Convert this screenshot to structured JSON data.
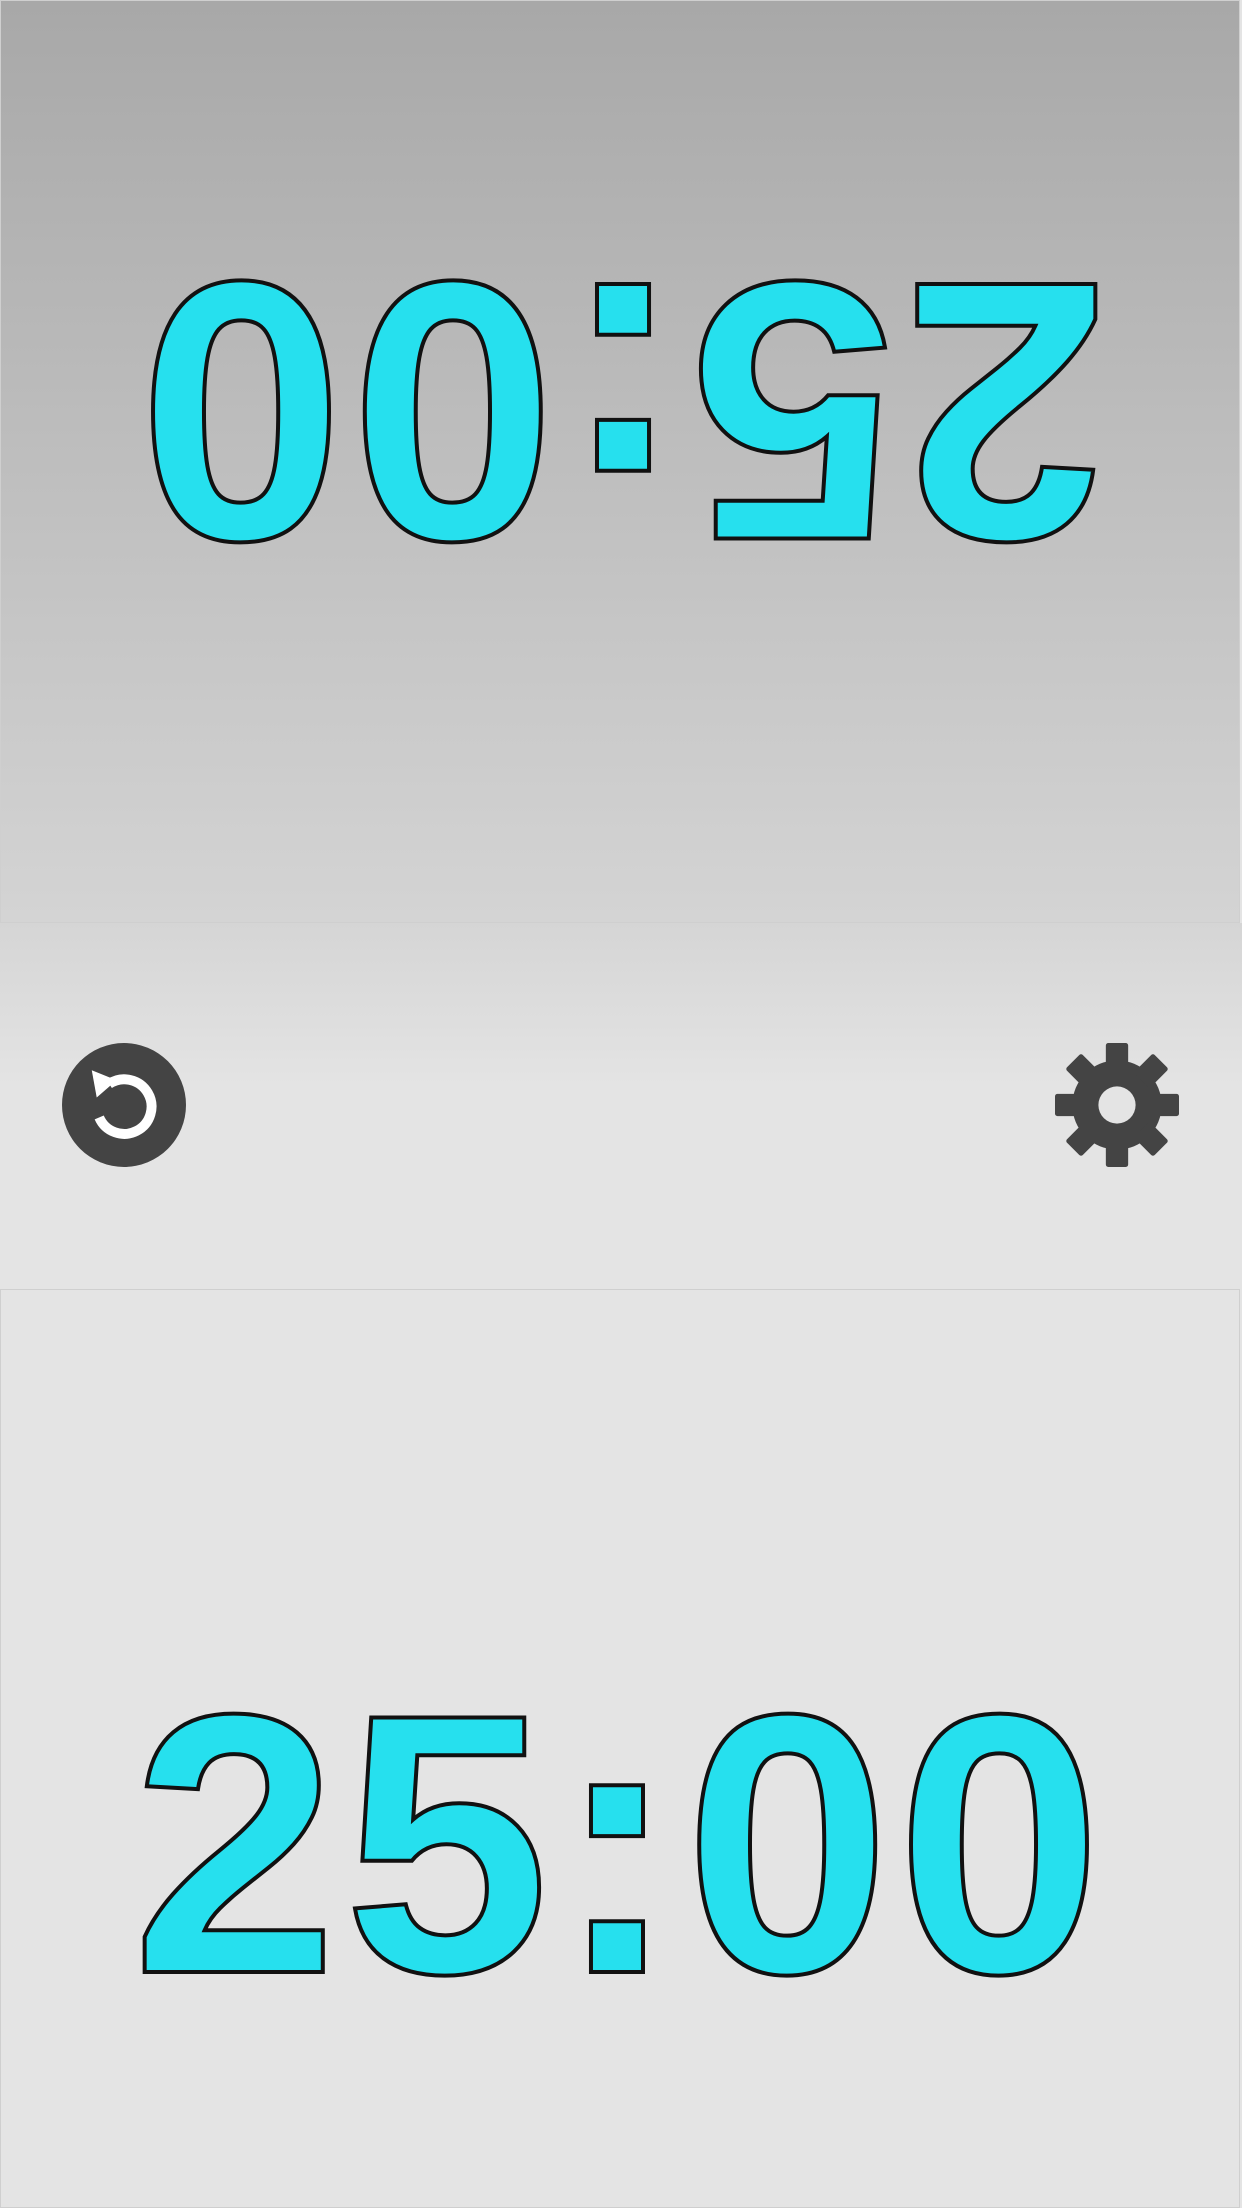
{
  "player_top": {
    "time": "25:00",
    "text_color": "#26e0ee"
  },
  "player_bottom": {
    "time": "25:00",
    "text_color": "#26e0ee"
  },
  "controls": {
    "reset_icon": "reset-icon",
    "settings_icon": "gear-icon",
    "icon_color": "#444444"
  }
}
